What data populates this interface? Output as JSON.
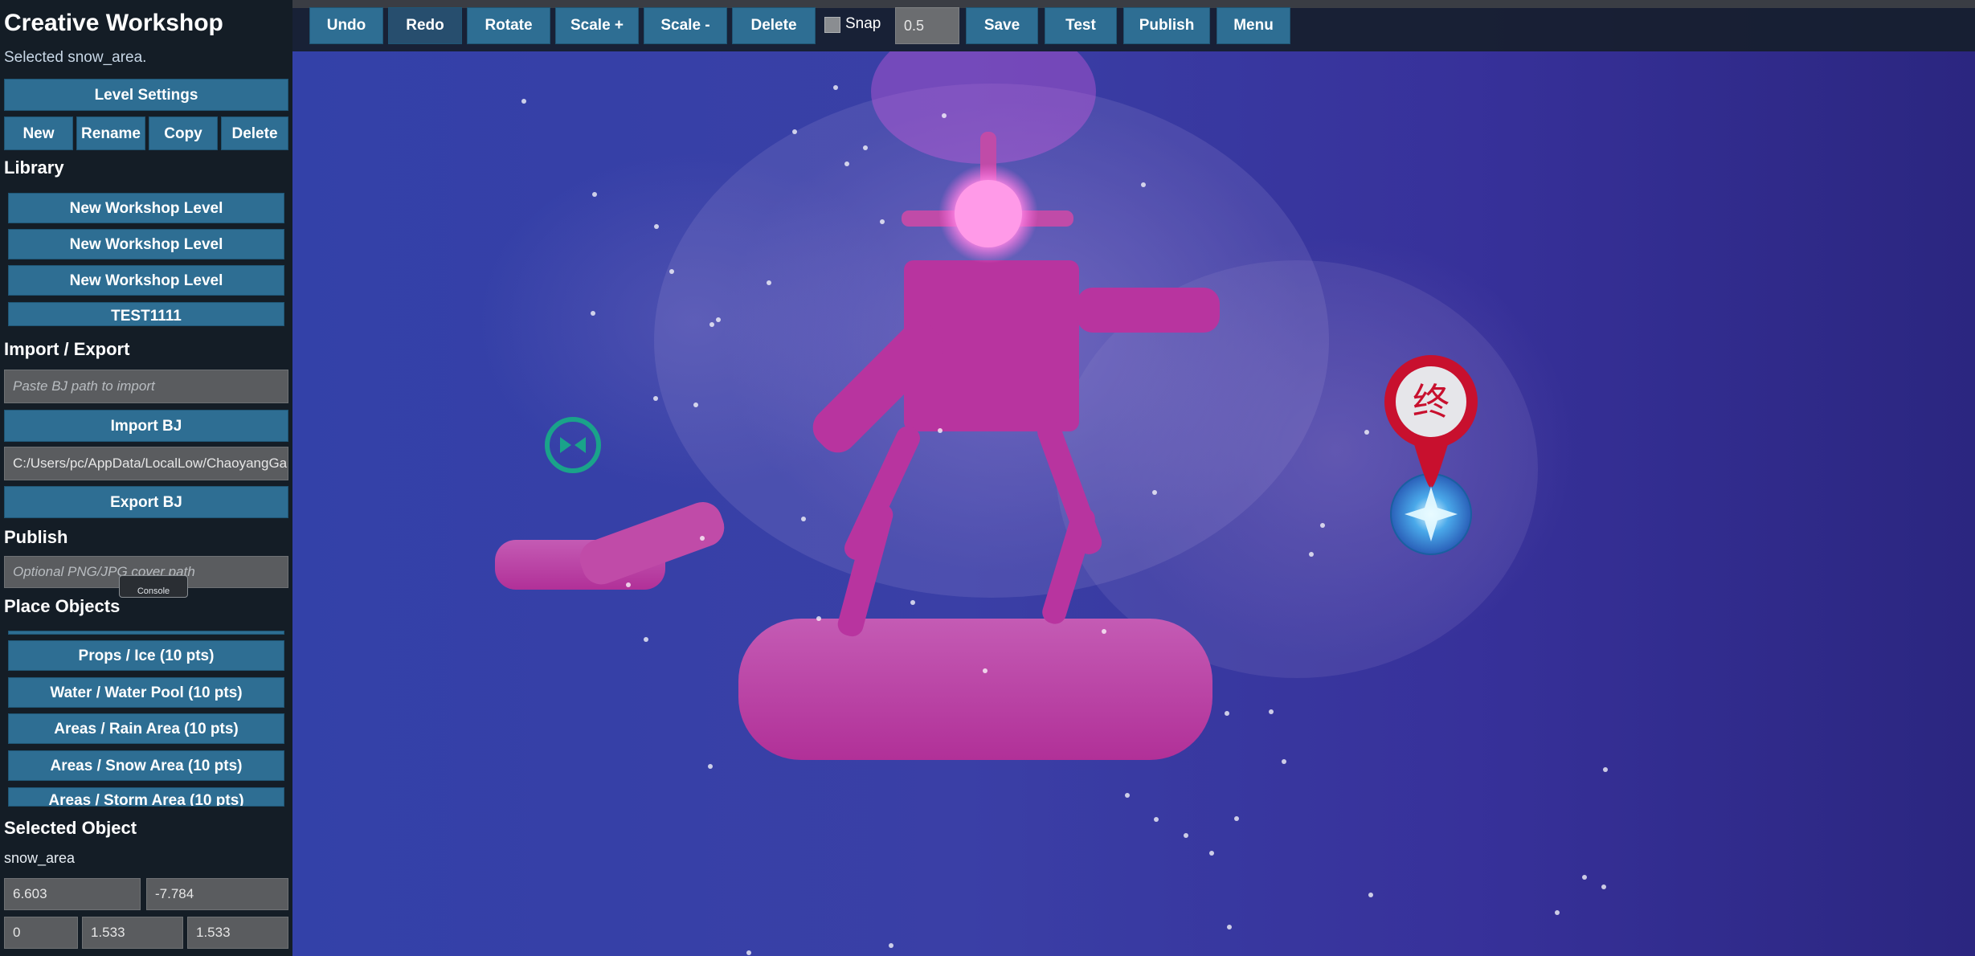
{
  "sidebar": {
    "title": "Creative Workshop",
    "status": "Selected snow_area.",
    "level_settings": "Level Settings",
    "level_buttons": [
      "New",
      "Rename",
      "Copy",
      "Delete"
    ],
    "library": {
      "heading": "Library",
      "items": [
        "New Workshop Level",
        "New Workshop Level",
        "New Workshop Level",
        "TEST1111"
      ]
    },
    "import_export": {
      "heading": "Import / Export",
      "import_placeholder": "Paste BJ path to import",
      "import_button": "Import BJ",
      "export_path": "C:/Users/pc/AppData/LocalLow/ChaoyangGa",
      "export_button": "Export BJ"
    },
    "publish": {
      "heading": "Publish",
      "cover_placeholder": "Optional PNG/JPG cover path"
    },
    "console_tip": "Console",
    "place_objects": {
      "heading": "Place Objects",
      "items": [
        "Props / Ice (10 pts)",
        "Water / Water Pool (10 pts)",
        "Areas / Rain Area (10 pts)",
        "Areas / Snow Area (10 pts)",
        "Areas / Storm Area (10 pts)"
      ]
    },
    "selected_object": {
      "heading": "Selected Object",
      "name": "snow_area",
      "position": [
        "6.603",
        "-7.784"
      ],
      "rotation_scale": [
        "0",
        "1.533",
        "1.533"
      ]
    }
  },
  "toolbar": {
    "buttons": [
      "Undo",
      "Redo",
      "Rotate",
      "Scale +",
      "Scale -",
      "Delete"
    ],
    "snap_label": "Snap",
    "snap_value": "0.5",
    "right_buttons": [
      "Save",
      "Test",
      "Publish",
      "Menu"
    ]
  },
  "scene": {
    "end_marker_glyph": "终"
  },
  "colors": {
    "button": "#2e6e93",
    "sidebar": "#141d26",
    "platform": "#b8349f",
    "goal_red": "#c8102e"
  }
}
